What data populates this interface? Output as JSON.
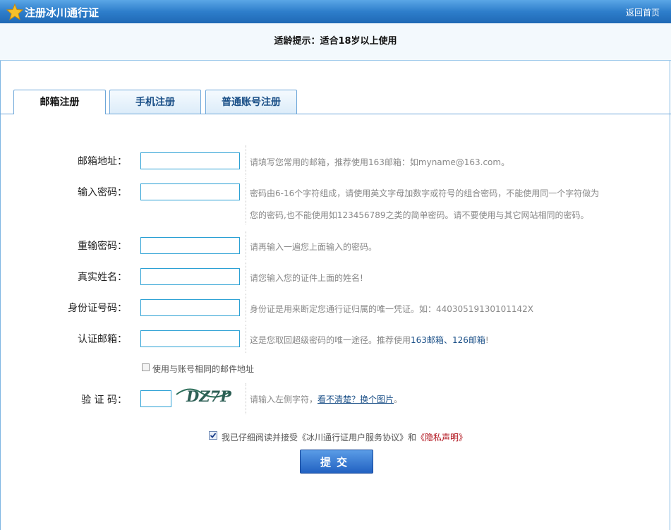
{
  "header": {
    "title": "注册冰川通行证",
    "home_link": "返回首页"
  },
  "notice": "适龄提示：适合18岁以上使用",
  "tabs": [
    {
      "label": "邮箱注册",
      "active": true
    },
    {
      "label": "手机注册",
      "active": false
    },
    {
      "label": "普通账号注册",
      "active": false
    }
  ],
  "form": {
    "email": {
      "label": "邮箱地址：",
      "value": "",
      "hint": "请填写您常用的邮箱，推荐使用163邮箱：如myname@163.com。"
    },
    "password": {
      "label": "输入密码：",
      "value": "",
      "hint_line1": "密码由6-16个字符组成，请使用英文字母加数字或符号的组合密码，不能使用同一个字符做为",
      "hint_line2": "您的密码,也不能使用如123456789之类的简单密码。请不要使用与其它网站相同的密码。"
    },
    "repeat_password": {
      "label": "重输密码：",
      "value": "",
      "hint": "请再输入一遍您上面输入的密码。"
    },
    "real_name": {
      "label": "真实姓名：",
      "value": "",
      "hint": "请您输入您的证件上面的姓名!"
    },
    "id_number": {
      "label": "身份证号码：",
      "value": "",
      "hint": "身份证是用来断定您通行证归属的唯一凭证。如：44030519130101142X"
    },
    "verify_email": {
      "label": "认证邮箱：",
      "value": "",
      "hint_prefix": "这是您取回超级密码的唯一途径。推荐使用",
      "link_163": "163邮箱",
      "sep": "、",
      "link_126": "126邮箱",
      "hint_suffix": "!"
    },
    "same_email_checkbox": {
      "label": "使用与账号相同的邮件地址",
      "checked": false
    },
    "captcha": {
      "label": "验 证 码：",
      "value": "",
      "image_text": "DZ7P",
      "hint_prefix": "请输入左侧字符，",
      "refresh_link": "看不清楚？换个图片",
      "hint_suffix": "。"
    }
  },
  "agreement": {
    "checked": true,
    "prefix": "我已仔细阅读并接受《冰川通行证用户服务协议》和",
    "privacy": "《隐私声明》"
  },
  "submit_label": "提交",
  "colors": {
    "titlebar": "#2e7ecb",
    "input_border": "#2aa0d4",
    "link": "#1a4f87",
    "privacy_red": "#b0101a"
  }
}
